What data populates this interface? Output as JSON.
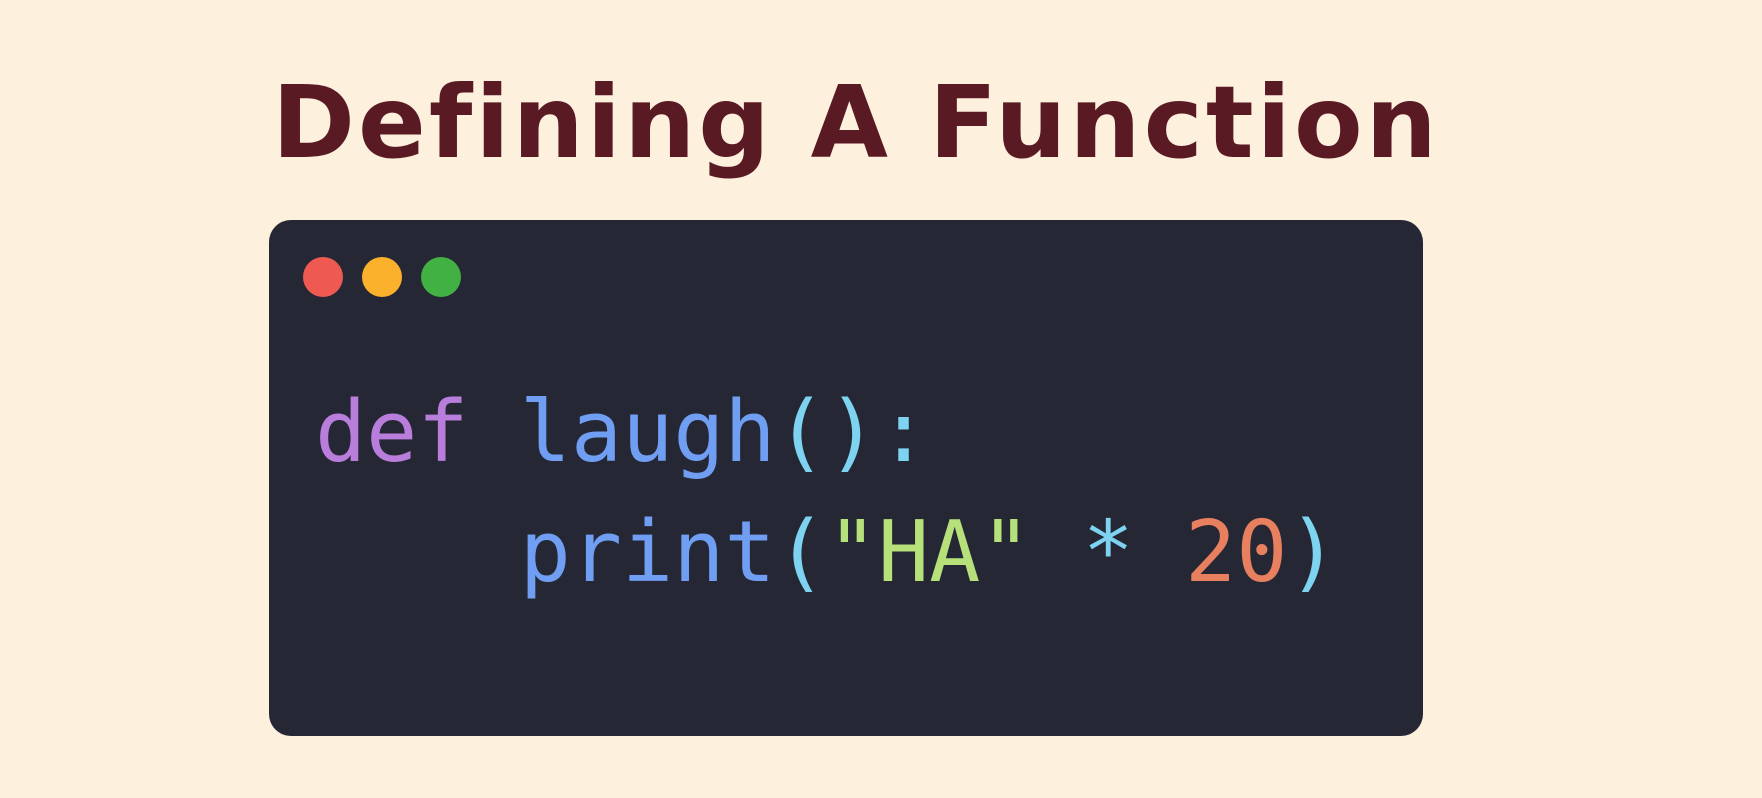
{
  "title": "Defining A Function",
  "window_controls": {
    "close": {
      "icon": "red-dot-icon",
      "color": "#ee5a52"
    },
    "minimize": {
      "icon": "yellow-dot-icon",
      "color": "#fbb12b"
    },
    "maximize": {
      "icon": "green-dot-icon",
      "color": "#40b142"
    }
  },
  "code": {
    "lines": [
      [
        {
          "text": "def",
          "color": "#b97edc"
        },
        {
          "text": " ",
          "color": "#ffffff"
        },
        {
          "text": "laugh",
          "color": "#6f9ef2"
        },
        {
          "text": "():",
          "color": "#7dd3f0"
        }
      ],
      [
        {
          "text": "    ",
          "color": "#ffffff"
        },
        {
          "text": "print",
          "color": "#6f9ef2"
        },
        {
          "text": "(",
          "color": "#7dd3f0"
        },
        {
          "text": "\"HA\"",
          "color": "#b6e07a"
        },
        {
          "text": " ",
          "color": "#ffffff"
        },
        {
          "text": "*",
          "color": "#7dd3f0"
        },
        {
          "text": " ",
          "color": "#ffffff"
        },
        {
          "text": "20",
          "color": "#e8805f"
        },
        {
          "text": ")",
          "color": "#7dd3f0"
        }
      ]
    ]
  }
}
